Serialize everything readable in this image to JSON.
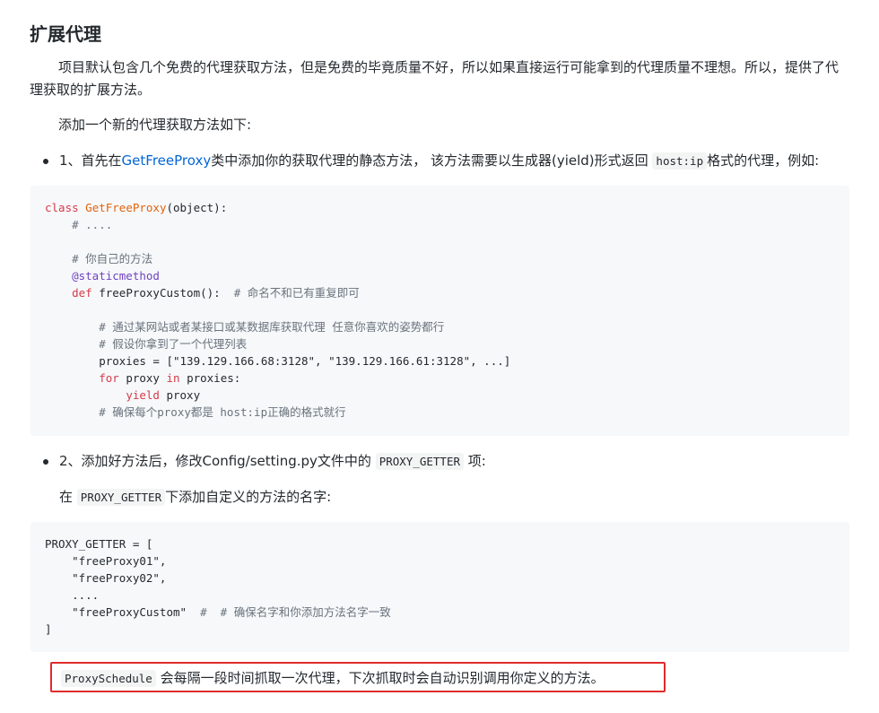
{
  "heading": "扩展代理",
  "intro": "项目默认包含几个免费的代理获取方法，但是免费的毕竟质量不好，所以如果直接运行可能拿到的代理质量不理想。所以，提供了代理获取的扩展方法。",
  "add_method": "添加一个新的代理获取方法如下:",
  "step1": {
    "prefix": "1、首先在",
    "link": "GetFreeProxy",
    "middle": "类中添加你的获取代理的静态方法， 该方法需要以生成器(yield)形式返回",
    "code": "host:ip",
    "suffix": "格式的代理，例如:"
  },
  "code1": {
    "l1_kw": "class",
    "l1_cls": "GetFreeProxy",
    "l1_rest": "(object):",
    "l2": "    # ....",
    "l4": "    # 你自己的方法",
    "l5": "    @staticmethod",
    "l6_kw": "def",
    "l6_rest": " freeProxyCustom():  ",
    "l6_cm": "# 命名不和已有重复即可",
    "l8": "        # 通过某网站或者某接口或某数据库获取代理 任意你喜欢的姿势都行",
    "l9": "        # 假设你拿到了一个代理列表",
    "l10": "        proxies = [\"139.129.166.68:3128\", \"139.129.166.61:3128\", ...]",
    "l11_kw": "for",
    "l11_a": " proxy ",
    "l11_in": "in",
    "l11_b": " proxies:",
    "l12_kw": "yield",
    "l12_rest": " proxy",
    "l13": "        # 确保每个proxy都是 host:ip正确的格式就行"
  },
  "step2": {
    "prefix": "2、添加好方法后，修改Config/setting.py文件中的",
    "code": "PROXY_GETTER",
    "suffix": "项:"
  },
  "step2b": {
    "prefix": "在",
    "code": "PROXY_GETTER",
    "suffix": "下添加自定义的方法的名字:"
  },
  "code2": {
    "l1": "PROXY_GETTER = [",
    "l2": "    \"freeProxy01\",",
    "l3": "    \"freeProxy02\",",
    "l4": "    ....",
    "l5_a": "    \"freeProxyCustom\"  ",
    "l5_cm": "#  # 确保名字和你添加方法名字一致",
    "l6": "]"
  },
  "note": {
    "code": "ProxySchedule",
    "text": "会每隔一段时间抓取一次代理，下次抓取时会自动识别调用你定义的方法。"
  }
}
